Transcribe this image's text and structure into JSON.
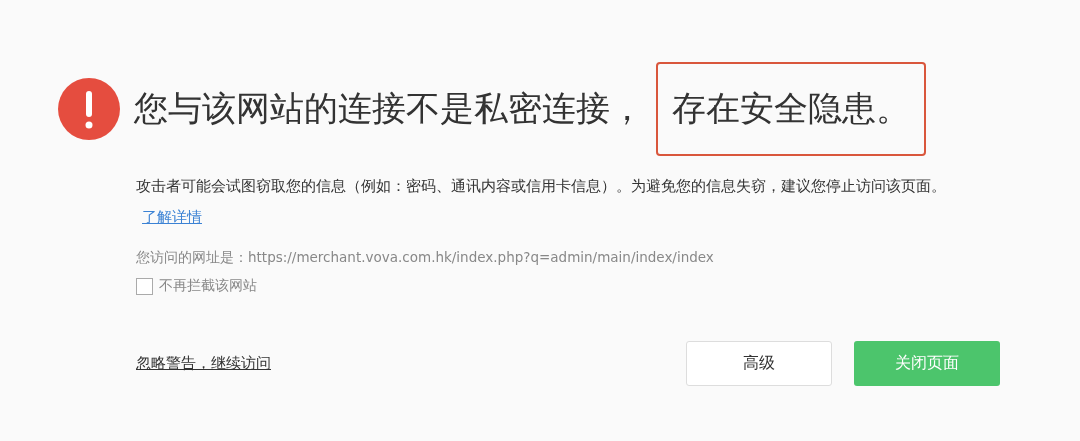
{
  "heading": {
    "parts": [
      {
        "text": "您与该网站的连接不是私密连接，",
        "highlighted": false
      },
      {
        "text": "存在安全隐患。",
        "highlighted": true
      }
    ]
  },
  "description": {
    "text": "攻击者可能会试图窃取您的信息（例如：密码、通讯内容或信用卡信息）。为避免您的信息失窃，建议您停止访问该页面。",
    "link": "了解详情"
  },
  "url_line": "您访问的网址是：https://merchant.vova.com.hk/index.php?q=admin/main/index/index",
  "checkbox": {
    "label": "不再拦截该网站",
    "checked": false
  },
  "ignore_link": "忽略警告，继续访问",
  "buttons": [
    {
      "label": "高级",
      "kind": "secondary"
    },
    {
      "label": "关闭页面",
      "kind": "primary"
    }
  ]
}
